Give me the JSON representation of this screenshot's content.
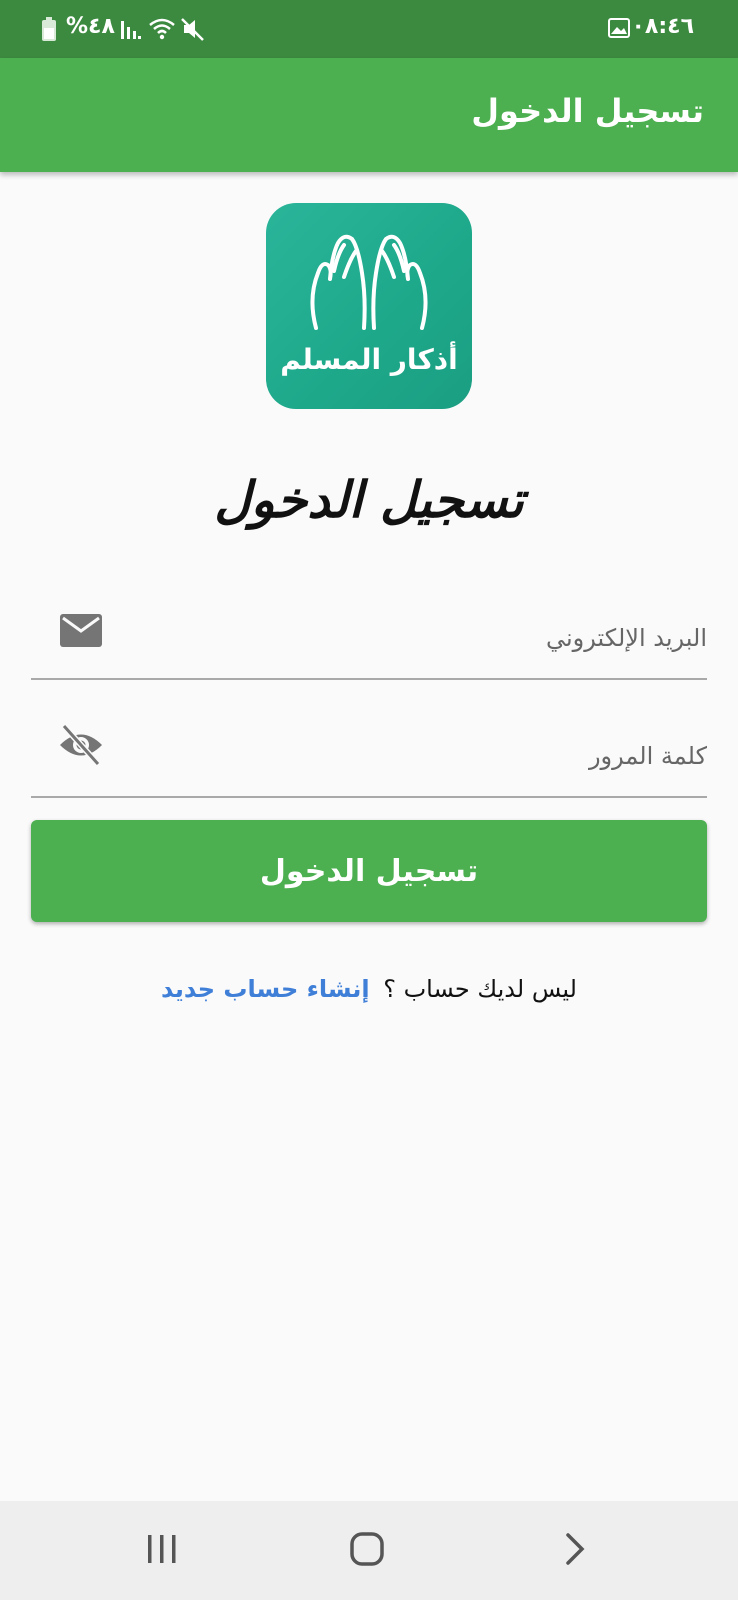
{
  "status_bar": {
    "time": "٠٨:٤٦",
    "battery_percent": "%٤٨",
    "icons": [
      "gallery-icon",
      "battery-icon",
      "signal-icon",
      "wifi-icon",
      "mute-icon"
    ]
  },
  "app_bar": {
    "title": "تسجيل الدخول"
  },
  "logo": {
    "caption": "أذكار المسلم",
    "icon": "praying-hands-icon"
  },
  "page_heading": "تسجيل الدخول",
  "form": {
    "email_placeholder": "البريد الإلكتروني",
    "email_value": "",
    "email_icon": "mail-icon",
    "password_placeholder": "كلمة المرور",
    "password_value": "",
    "password_icon": "eye-off-icon",
    "submit_label": "تسجيل الدخول"
  },
  "signup": {
    "prompt": "ليس لديك حساب ؟",
    "link_label": "إنشاء حساب جديد"
  },
  "nav_bar": {
    "icons": [
      "recents-icon",
      "home-icon",
      "back-icon"
    ]
  },
  "colors": {
    "status_bar": "#3c8a3f",
    "primary": "#4caf50",
    "logo_bg": "#1ea88a",
    "link": "#3f7fd8"
  }
}
